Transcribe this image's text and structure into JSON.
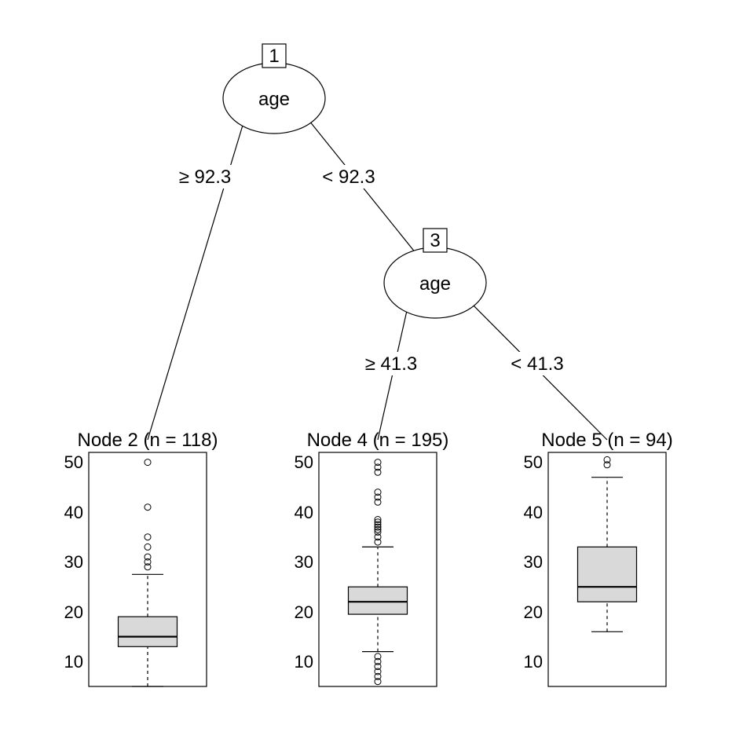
{
  "tree": {
    "node1": {
      "id": "1",
      "var": "age",
      "left_rule": "≥ 92.3",
      "right_rule": "< 92.3"
    },
    "node3": {
      "id": "3",
      "var": "age",
      "left_rule": "≥ 41.3",
      "right_rule": "< 41.3"
    }
  },
  "terminals": {
    "node2": {
      "title": "Node 2 (n = 118)"
    },
    "node4": {
      "title": "Node 4 (n = 195)"
    },
    "node5": {
      "title": "Node 5 (n = 94)"
    }
  },
  "axis_ticks": [
    "10",
    "20",
    "30",
    "40",
    "50"
  ],
  "chart_data": {
    "type": "boxplot",
    "ylim": [
      5,
      52
    ],
    "ticks": [
      10,
      20,
      30,
      40,
      50
    ],
    "panels": [
      {
        "id": "node2",
        "n": 118,
        "lower_whisker": 5,
        "q1": 13,
        "median": 15,
        "q3": 19,
        "upper_whisker": 27.5,
        "outliers": [
          29,
          30,
          31,
          33,
          35,
          41,
          50
        ]
      },
      {
        "id": "node4",
        "n": 195,
        "lower_whisker": 12,
        "q1": 19.5,
        "median": 22,
        "q3": 25,
        "upper_whisker": 33,
        "outliers": [
          6,
          7,
          8,
          9,
          10,
          11,
          34,
          35,
          36,
          36.5,
          37,
          37.5,
          38,
          38.5,
          42,
          43,
          44,
          48,
          49,
          50
        ]
      },
      {
        "id": "node5",
        "n": 94,
        "lower_whisker": 16,
        "q1": 22,
        "median": 25,
        "q3": 33,
        "upper_whisker": 47,
        "outliers": [
          49.5,
          50.5
        ]
      }
    ]
  }
}
